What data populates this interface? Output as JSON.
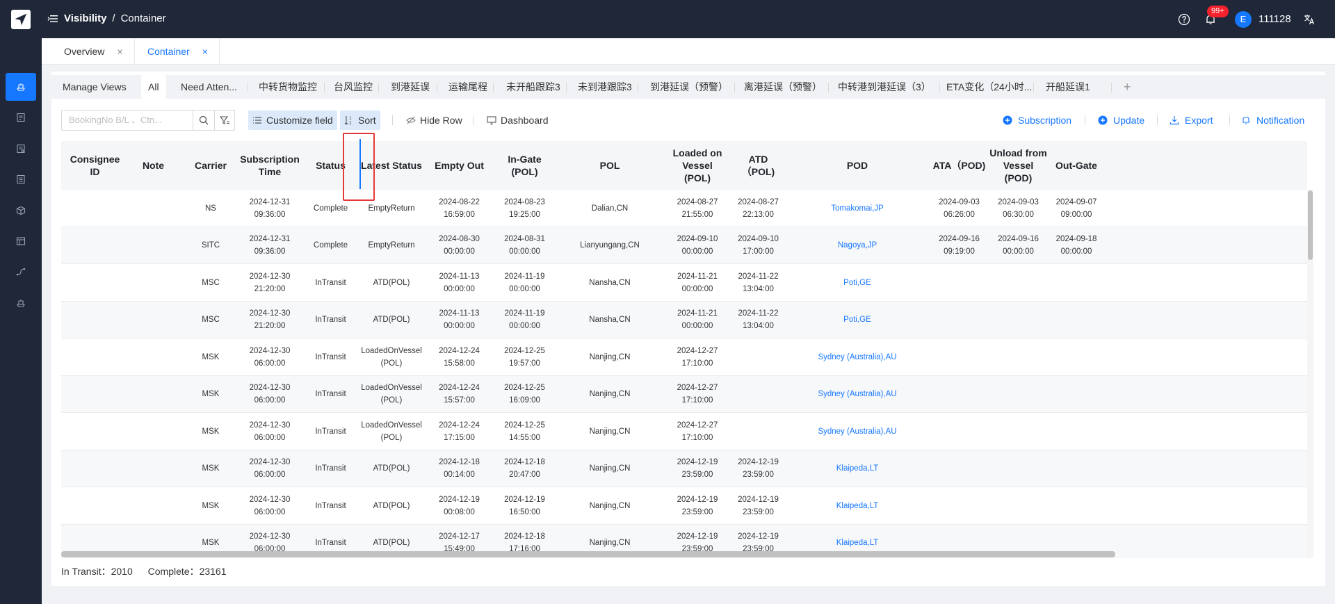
{
  "header": {
    "breadcrumb_root": "Visibility",
    "breadcrumb_sep": "/",
    "breadcrumb_current": "Container",
    "notification_badge": "99+",
    "avatar_initial": "E",
    "user_name": "111128"
  },
  "page_tabs": [
    {
      "label": "Overview",
      "close": "×"
    },
    {
      "label": "Container",
      "close": "×"
    }
  ],
  "view_tabs": [
    "Manage Views",
    "All",
    "Need Atten...",
    "中转货物监控",
    "台风监控",
    "到港延误",
    "运输尾程",
    "未开船跟踪3",
    "未到港跟踪3",
    "到港延误（预警）",
    "离港延误（预警）",
    "中转港到港延误（3）",
    "ETA变化（24小时...",
    "开船延误1"
  ],
  "view_tab_add": "+",
  "toolbar": {
    "search_placeholder": "BookingNo B/L 、Ctn...",
    "customize_field": "Customize field",
    "sort": "Sort",
    "hide_row": "Hide Row",
    "dashboard": "Dashboard",
    "subscription": "Subscription",
    "update": "Update",
    "export": "Export",
    "notification": "Notification"
  },
  "table": {
    "columns": [
      "Consignee ID",
      "Note",
      "Carrier",
      "Subscription Time",
      "Status",
      "Latest Status",
      "Empty Out",
      "In-Gate (POL)",
      "POL",
      "Loaded on Vessel (POL)",
      "ATD（POL)",
      "POD",
      "ATA（POD)",
      "Unload from Vessel (POD)",
      "Out-Gate"
    ],
    "column_lines": [
      [
        "Consignee ID"
      ],
      [
        "Note"
      ],
      [
        "Carrier"
      ],
      [
        "Subscription",
        "Time"
      ],
      [
        "Status"
      ],
      [
        "Latest Status"
      ],
      [
        "Empty Out"
      ],
      [
        "In-Gate",
        "(POL)"
      ],
      [
        "POL"
      ],
      [
        "Loaded on",
        "Vessel",
        "(POL)"
      ],
      [
        "ATD（POL)"
      ],
      [
        "POD"
      ],
      [
        "ATA（POD)"
      ],
      [
        "Unload from",
        "Vessel",
        "(POD)"
      ],
      [
        "Out-Gate"
      ]
    ],
    "rows": [
      {
        "consignee": "",
        "note": "",
        "carrier": "NS",
        "sub_time": [
          "2024-12-31",
          "09:36:00"
        ],
        "status": "Complete",
        "latest": [
          "EmptyReturn"
        ],
        "empty_out": [
          "2024-08-22",
          "16:59:00"
        ],
        "in_gate": [
          "2024-08-23",
          "19:25:00"
        ],
        "pol": "Dalian,CN",
        "loaded": [
          "2024-08-27",
          "21:55:00"
        ],
        "atd": [
          "2024-08-27",
          "22:13:00"
        ],
        "pod": "Tomakomai,JP",
        "ata": [
          "2024-09-03",
          "06:26:00"
        ],
        "unload": [
          "2024-09-03",
          "06:30:00"
        ],
        "out_gate": [
          "2024-09-07",
          "09:00:00"
        ]
      },
      {
        "consignee": "",
        "note": "",
        "carrier": "SITC",
        "sub_time": [
          "2024-12-31",
          "09:36:00"
        ],
        "status": "Complete",
        "latest": [
          "EmptyReturn"
        ],
        "empty_out": [
          "2024-08-30",
          "00:00:00"
        ],
        "in_gate": [
          "2024-08-31",
          "00:00:00"
        ],
        "pol": "Lianyungang,CN",
        "loaded": [
          "2024-09-10",
          "00:00:00"
        ],
        "atd": [
          "2024-09-10",
          "17:00:00"
        ],
        "pod": "Nagoya,JP",
        "ata": [
          "2024-09-16",
          "09:19:00"
        ],
        "unload": [
          "2024-09-16",
          "00:00:00"
        ],
        "out_gate": [
          "2024-09-18",
          "00:00:00"
        ]
      },
      {
        "consignee": "",
        "note": "",
        "carrier": "MSC",
        "sub_time": [
          "2024-12-30",
          "21:20:00"
        ],
        "status": "InTransit",
        "latest": [
          "ATD(POL)"
        ],
        "empty_out": [
          "2024-11-13",
          "00:00:00"
        ],
        "in_gate": [
          "2024-11-19",
          "00:00:00"
        ],
        "pol": "Nansha,CN",
        "loaded": [
          "2024-11-21",
          "00:00:00"
        ],
        "atd": [
          "2024-11-22",
          "13:04:00"
        ],
        "pod": "Poti,GE",
        "ata": [
          "",
          ""
        ],
        "unload": [
          "",
          ""
        ],
        "out_gate": [
          "",
          ""
        ]
      },
      {
        "consignee": "",
        "note": "",
        "carrier": "MSC",
        "sub_time": [
          "2024-12-30",
          "21:20:00"
        ],
        "status": "InTransit",
        "latest": [
          "ATD(POL)"
        ],
        "empty_out": [
          "2024-11-13",
          "00:00:00"
        ],
        "in_gate": [
          "2024-11-19",
          "00:00:00"
        ],
        "pol": "Nansha,CN",
        "loaded": [
          "2024-11-21",
          "00:00:00"
        ],
        "atd": [
          "2024-11-22",
          "13:04:00"
        ],
        "pod": "Poti,GE",
        "ata": [
          "",
          ""
        ],
        "unload": [
          "",
          ""
        ],
        "out_gate": [
          "",
          ""
        ]
      },
      {
        "consignee": "",
        "note": "",
        "carrier": "MSK",
        "sub_time": [
          "2024-12-30",
          "06:00:00"
        ],
        "status": "InTransit",
        "latest": [
          "LoadedOnVessel",
          "(POL)"
        ],
        "empty_out": [
          "2024-12-24",
          "15:58:00"
        ],
        "in_gate": [
          "2024-12-25",
          "19:57:00"
        ],
        "pol": "Nanjing,CN",
        "loaded": [
          "2024-12-27",
          "17:10:00"
        ],
        "atd": [
          "",
          ""
        ],
        "pod": "Sydney (Australia),AU",
        "ata": [
          "",
          ""
        ],
        "unload": [
          "",
          ""
        ],
        "out_gate": [
          "",
          ""
        ]
      },
      {
        "consignee": "",
        "note": "",
        "carrier": "MSK",
        "sub_time": [
          "2024-12-30",
          "06:00:00"
        ],
        "status": "InTransit",
        "latest": [
          "LoadedOnVessel",
          "(POL)"
        ],
        "empty_out": [
          "2024-12-24",
          "15:57:00"
        ],
        "in_gate": [
          "2024-12-25",
          "16:09:00"
        ],
        "pol": "Nanjing,CN",
        "loaded": [
          "2024-12-27",
          "17:10:00"
        ],
        "atd": [
          "",
          ""
        ],
        "pod": "Sydney (Australia),AU",
        "ata": [
          "",
          ""
        ],
        "unload": [
          "",
          ""
        ],
        "out_gate": [
          "",
          ""
        ]
      },
      {
        "consignee": "",
        "note": "",
        "carrier": "MSK",
        "sub_time": [
          "2024-12-30",
          "06:00:00"
        ],
        "status": "InTransit",
        "latest": [
          "LoadedOnVessel",
          "(POL)"
        ],
        "empty_out": [
          "2024-12-24",
          "17:15:00"
        ],
        "in_gate": [
          "2024-12-25",
          "14:55:00"
        ],
        "pol": "Nanjing,CN",
        "loaded": [
          "2024-12-27",
          "17:10:00"
        ],
        "atd": [
          "",
          ""
        ],
        "pod": "Sydney (Australia),AU",
        "ata": [
          "",
          ""
        ],
        "unload": [
          "",
          ""
        ],
        "out_gate": [
          "",
          ""
        ]
      },
      {
        "consignee": "",
        "note": "",
        "carrier": "MSK",
        "sub_time": [
          "2024-12-30",
          "06:00:00"
        ],
        "status": "InTransit",
        "latest": [
          "ATD(POL)"
        ],
        "empty_out": [
          "2024-12-18",
          "00:14:00"
        ],
        "in_gate": [
          "2024-12-18",
          "20:47:00"
        ],
        "pol": "Nanjing,CN",
        "loaded": [
          "2024-12-19",
          "23:59:00"
        ],
        "atd": [
          "2024-12-19",
          "23:59:00"
        ],
        "pod": "Klaipeda,LT",
        "ata": [
          "",
          ""
        ],
        "unload": [
          "",
          ""
        ],
        "out_gate": [
          "",
          ""
        ]
      },
      {
        "consignee": "",
        "note": "",
        "carrier": "MSK",
        "sub_time": [
          "2024-12-30",
          "06:00:00"
        ],
        "status": "InTransit",
        "latest": [
          "ATD(POL)"
        ],
        "empty_out": [
          "2024-12-19",
          "00:08:00"
        ],
        "in_gate": [
          "2024-12-19",
          "16:50:00"
        ],
        "pol": "Nanjing,CN",
        "loaded": [
          "2024-12-19",
          "23:59:00"
        ],
        "atd": [
          "2024-12-19",
          "23:59:00"
        ],
        "pod": "Klaipeda,LT",
        "ata": [
          "",
          ""
        ],
        "unload": [
          "",
          ""
        ],
        "out_gate": [
          "",
          ""
        ]
      },
      {
        "consignee": "",
        "note": "",
        "carrier": "MSK",
        "sub_time": [
          "2024-12-30",
          "06:00:00"
        ],
        "status": "InTransit",
        "latest": [
          "ATD(POL)"
        ],
        "empty_out": [
          "2024-12-17",
          "15:49:00"
        ],
        "in_gate": [
          "2024-12-18",
          "17:16:00"
        ],
        "pol": "Nanjing,CN",
        "loaded": [
          "2024-12-19",
          "23:59:00"
        ],
        "atd": [
          "2024-12-19",
          "23:59:00"
        ],
        "pod": "Klaipeda,LT",
        "ata": [
          "",
          ""
        ],
        "unload": [
          "",
          ""
        ],
        "out_gate": [
          "",
          ""
        ]
      }
    ]
  },
  "footer": {
    "in_transit_label": "In Transit：",
    "in_transit_value": "2010",
    "complete_label": "Complete：",
    "complete_value": "23161"
  },
  "colors": {
    "accent": "#1677ff",
    "topbar": "#1f2738",
    "highlight_box": "#e53935"
  },
  "icons": {
    "logo": "paper-plane-icon",
    "sidebar": [
      "ship-icon",
      "document-icon",
      "list-icon",
      "file-icon",
      "package-icon",
      "board-icon",
      "route-icon",
      "ship-alt-icon"
    ]
  }
}
